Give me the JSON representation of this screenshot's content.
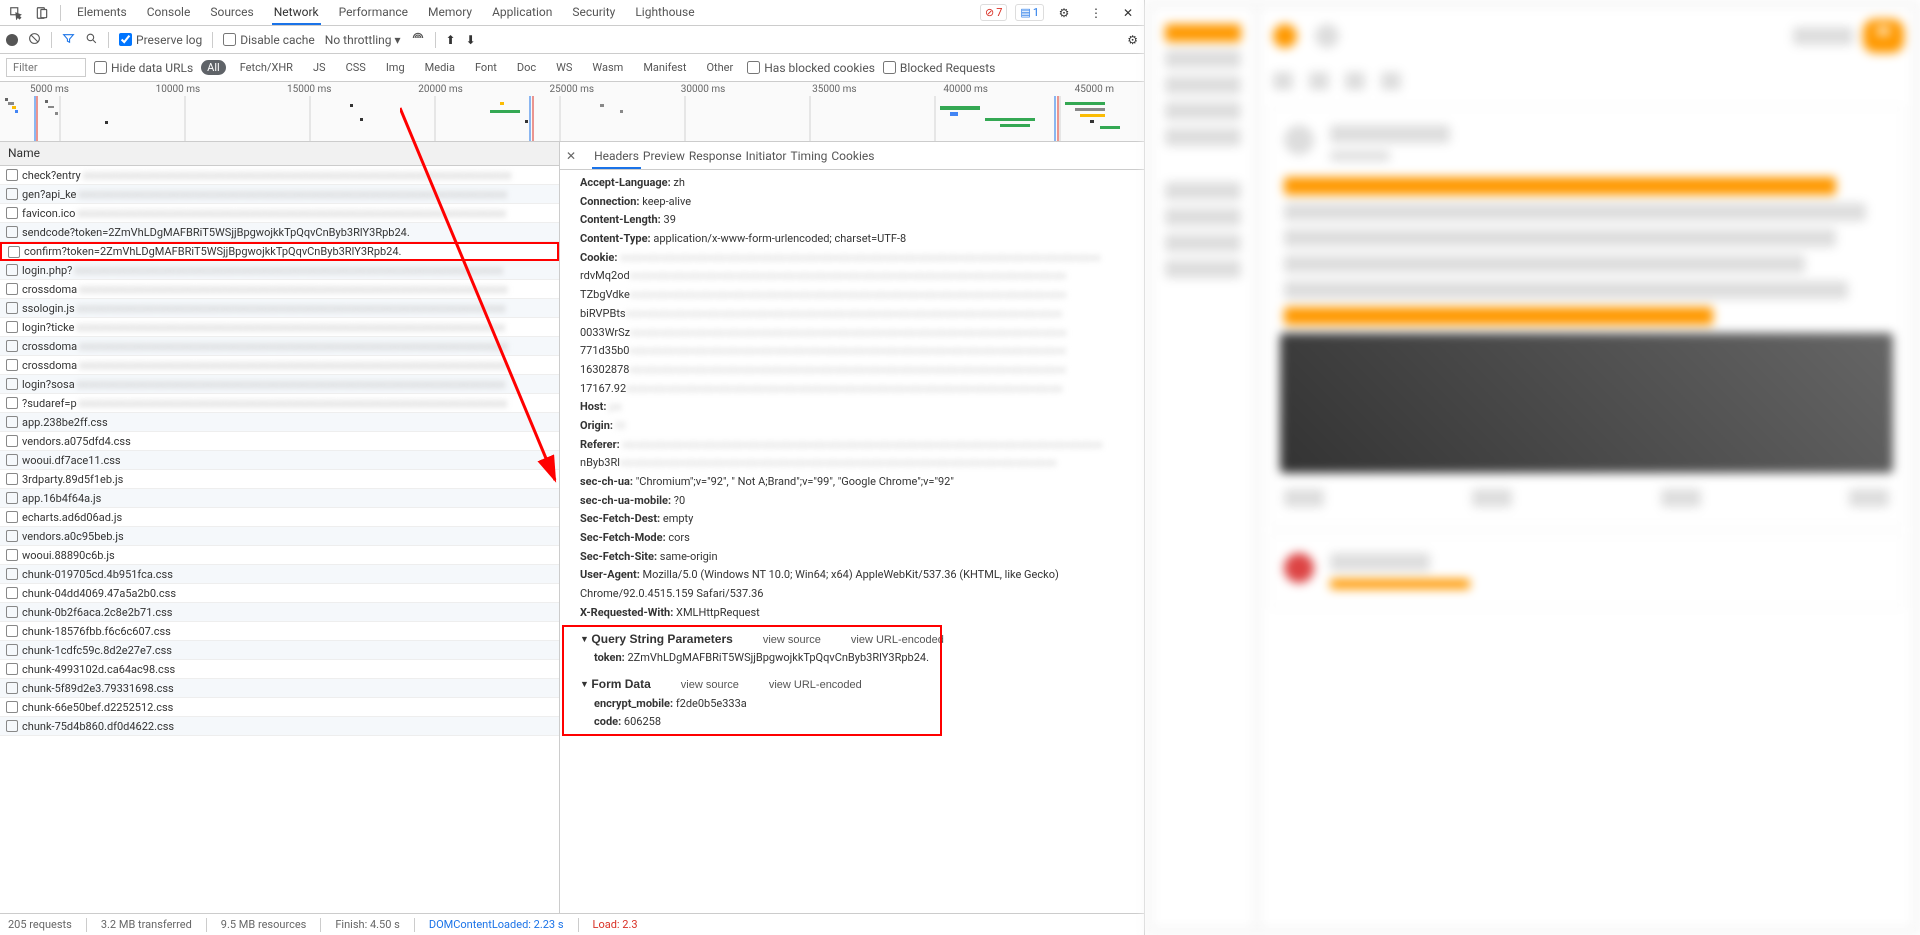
{
  "main_tabs": [
    "Elements",
    "Console",
    "Sources",
    "Network",
    "Performance",
    "Memory",
    "Application",
    "Security",
    "Lighthouse"
  ],
  "main_tab_active": "Network",
  "error_count": "7",
  "info_count": "1",
  "preserve_log": "Preserve log",
  "disable_cache": "Disable cache",
  "throttling": "No throttling",
  "filter_placeholder": "Filter",
  "hide_data_urls": "Hide data URLs",
  "filter_chips": [
    "All",
    "Fetch/XHR",
    "JS",
    "CSS",
    "Img",
    "Media",
    "Font",
    "Doc",
    "WS",
    "Wasm",
    "Manifest",
    "Other"
  ],
  "filter_chip_active": "All",
  "has_blocked_cookies": "Has blocked cookies",
  "blocked_requests": "Blocked Requests",
  "timeline_ticks": [
    "5000 ms",
    "10000 ms",
    "15000 ms",
    "20000 ms",
    "25000 ms",
    "30000 ms",
    "35000 ms",
    "40000 ms",
    "45000 m"
  ],
  "name_col": "Name",
  "requests": [
    {
      "name": "check?entry"
    },
    {
      "name": "gen?api_ke"
    },
    {
      "name": "favicon.ico"
    },
    {
      "name": "sendcode?token=2ZmVhLDgMAFBRiT5WSjjBpgwojkkTpQqvCnByb3RlY3Rpb24."
    },
    {
      "name": "confirm?token=2ZmVhLDgMAFBRiT5WSjjBpgwojkkTpQqvCnByb3RlY3Rpb24.",
      "hl": true
    },
    {
      "name": "login.php?"
    },
    {
      "name": "crossdoma"
    },
    {
      "name": "ssologin.js"
    },
    {
      "name": "login?ticke"
    },
    {
      "name": "crossdoma"
    },
    {
      "name": "crossdoma"
    },
    {
      "name": "login?sosa"
    },
    {
      "name": "?sudaref=p"
    },
    {
      "name": "app.238be2ff.css"
    },
    {
      "name": "vendors.a075dfd4.css"
    },
    {
      "name": "wooui.df7ace11.css"
    },
    {
      "name": "3rdparty.89d5f1eb.js"
    },
    {
      "name": "app.16b4f64a.js"
    },
    {
      "name": "echarts.ad6d06ad.js"
    },
    {
      "name": "vendors.a0c95beb.js"
    },
    {
      "name": "wooui.88890c6b.js"
    },
    {
      "name": "chunk-019705cd.4b951fca.css"
    },
    {
      "name": "chunk-04dd4069.47a5a2b0.css"
    },
    {
      "name": "chunk-0b2f6aca.2c8e2b71.css"
    },
    {
      "name": "chunk-18576fbb.f6c6c607.css"
    },
    {
      "name": "chunk-1cdfc59c.8d2e27e7.css"
    },
    {
      "name": "chunk-4993102d.ca64ac98.css"
    },
    {
      "name": "chunk-5f89d2e3.79331698.css"
    },
    {
      "name": "chunk-66e50bef.d2252512.css"
    },
    {
      "name": "chunk-75d4b860.df0d4622.css"
    }
  ],
  "detail_tabs": [
    "Headers",
    "Preview",
    "Response",
    "Initiator",
    "Timing",
    "Cookies"
  ],
  "detail_tab_active": "Headers",
  "headers": [
    {
      "k": "Accept-Language:",
      "v": "zh"
    },
    {
      "k": "Connection:",
      "v": "keep-alive"
    },
    {
      "k": "Content-Length:",
      "v": "39"
    },
    {
      "k": "Content-Type:",
      "v": "application/x-www-form-urlencoded; charset=UTF-8"
    },
    {
      "k": "Cookie:",
      "v": "",
      "blur": true,
      "lines": [
        "rdvMq2od",
        "TZbgVdke",
        "biRVPBts",
        "0033WrSz",
        "771d35b0",
        "16302878",
        "17167.92"
      ]
    },
    {
      "k": "Host:",
      "v": "pa",
      "blur": true
    },
    {
      "k": "Origin:",
      "v": "ht",
      "blur": true
    },
    {
      "k": "Referer:",
      "v": "",
      "blur": true,
      "lines": [
        "nByb3Rl"
      ]
    },
    {
      "k": "sec-ch-ua:",
      "v": "\"Chromium\";v=\"92\", \" Not A;Brand\";v=\"99\", \"Google Chrome\";v=\"92\""
    },
    {
      "k": "sec-ch-ua-mobile:",
      "v": "?0"
    },
    {
      "k": "Sec-Fetch-Dest:",
      "v": "empty"
    },
    {
      "k": "Sec-Fetch-Mode:",
      "v": "cors"
    },
    {
      "k": "Sec-Fetch-Site:",
      "v": "same-origin"
    },
    {
      "k": "User-Agent:",
      "v": "Mozilla/5.0 (Windows NT 10.0; Win64; x64) AppleWebKit/537.36 (KHTML, like Gecko) Chrome/92.0.4515.159 Safari/537.36"
    },
    {
      "k": "X-Requested-With:",
      "v": "XMLHttpRequest"
    }
  ],
  "qsp_title": "Query String Parameters",
  "view_source": "view source",
  "view_url_enc": "view URL-encoded",
  "qsp": [
    {
      "k": "token:",
      "v": "2ZmVhLDgMAFBRiT5WSjjBpgwojkkTpQqvCnByb3RlY3Rpb24."
    }
  ],
  "form_title": "Form Data",
  "form": [
    {
      "k": "encrypt_mobile:",
      "v": "f2de0b5e333a"
    },
    {
      "k": "code:",
      "v": "606258"
    }
  ],
  "status": {
    "requests": "205 requests",
    "transferred": "3.2 MB transferred",
    "resources": "9.5 MB resources",
    "finish": "Finish: 4.50 s",
    "dcl": "DOMContentLoaded: 2.23 s",
    "load": "Load: 2.3"
  }
}
